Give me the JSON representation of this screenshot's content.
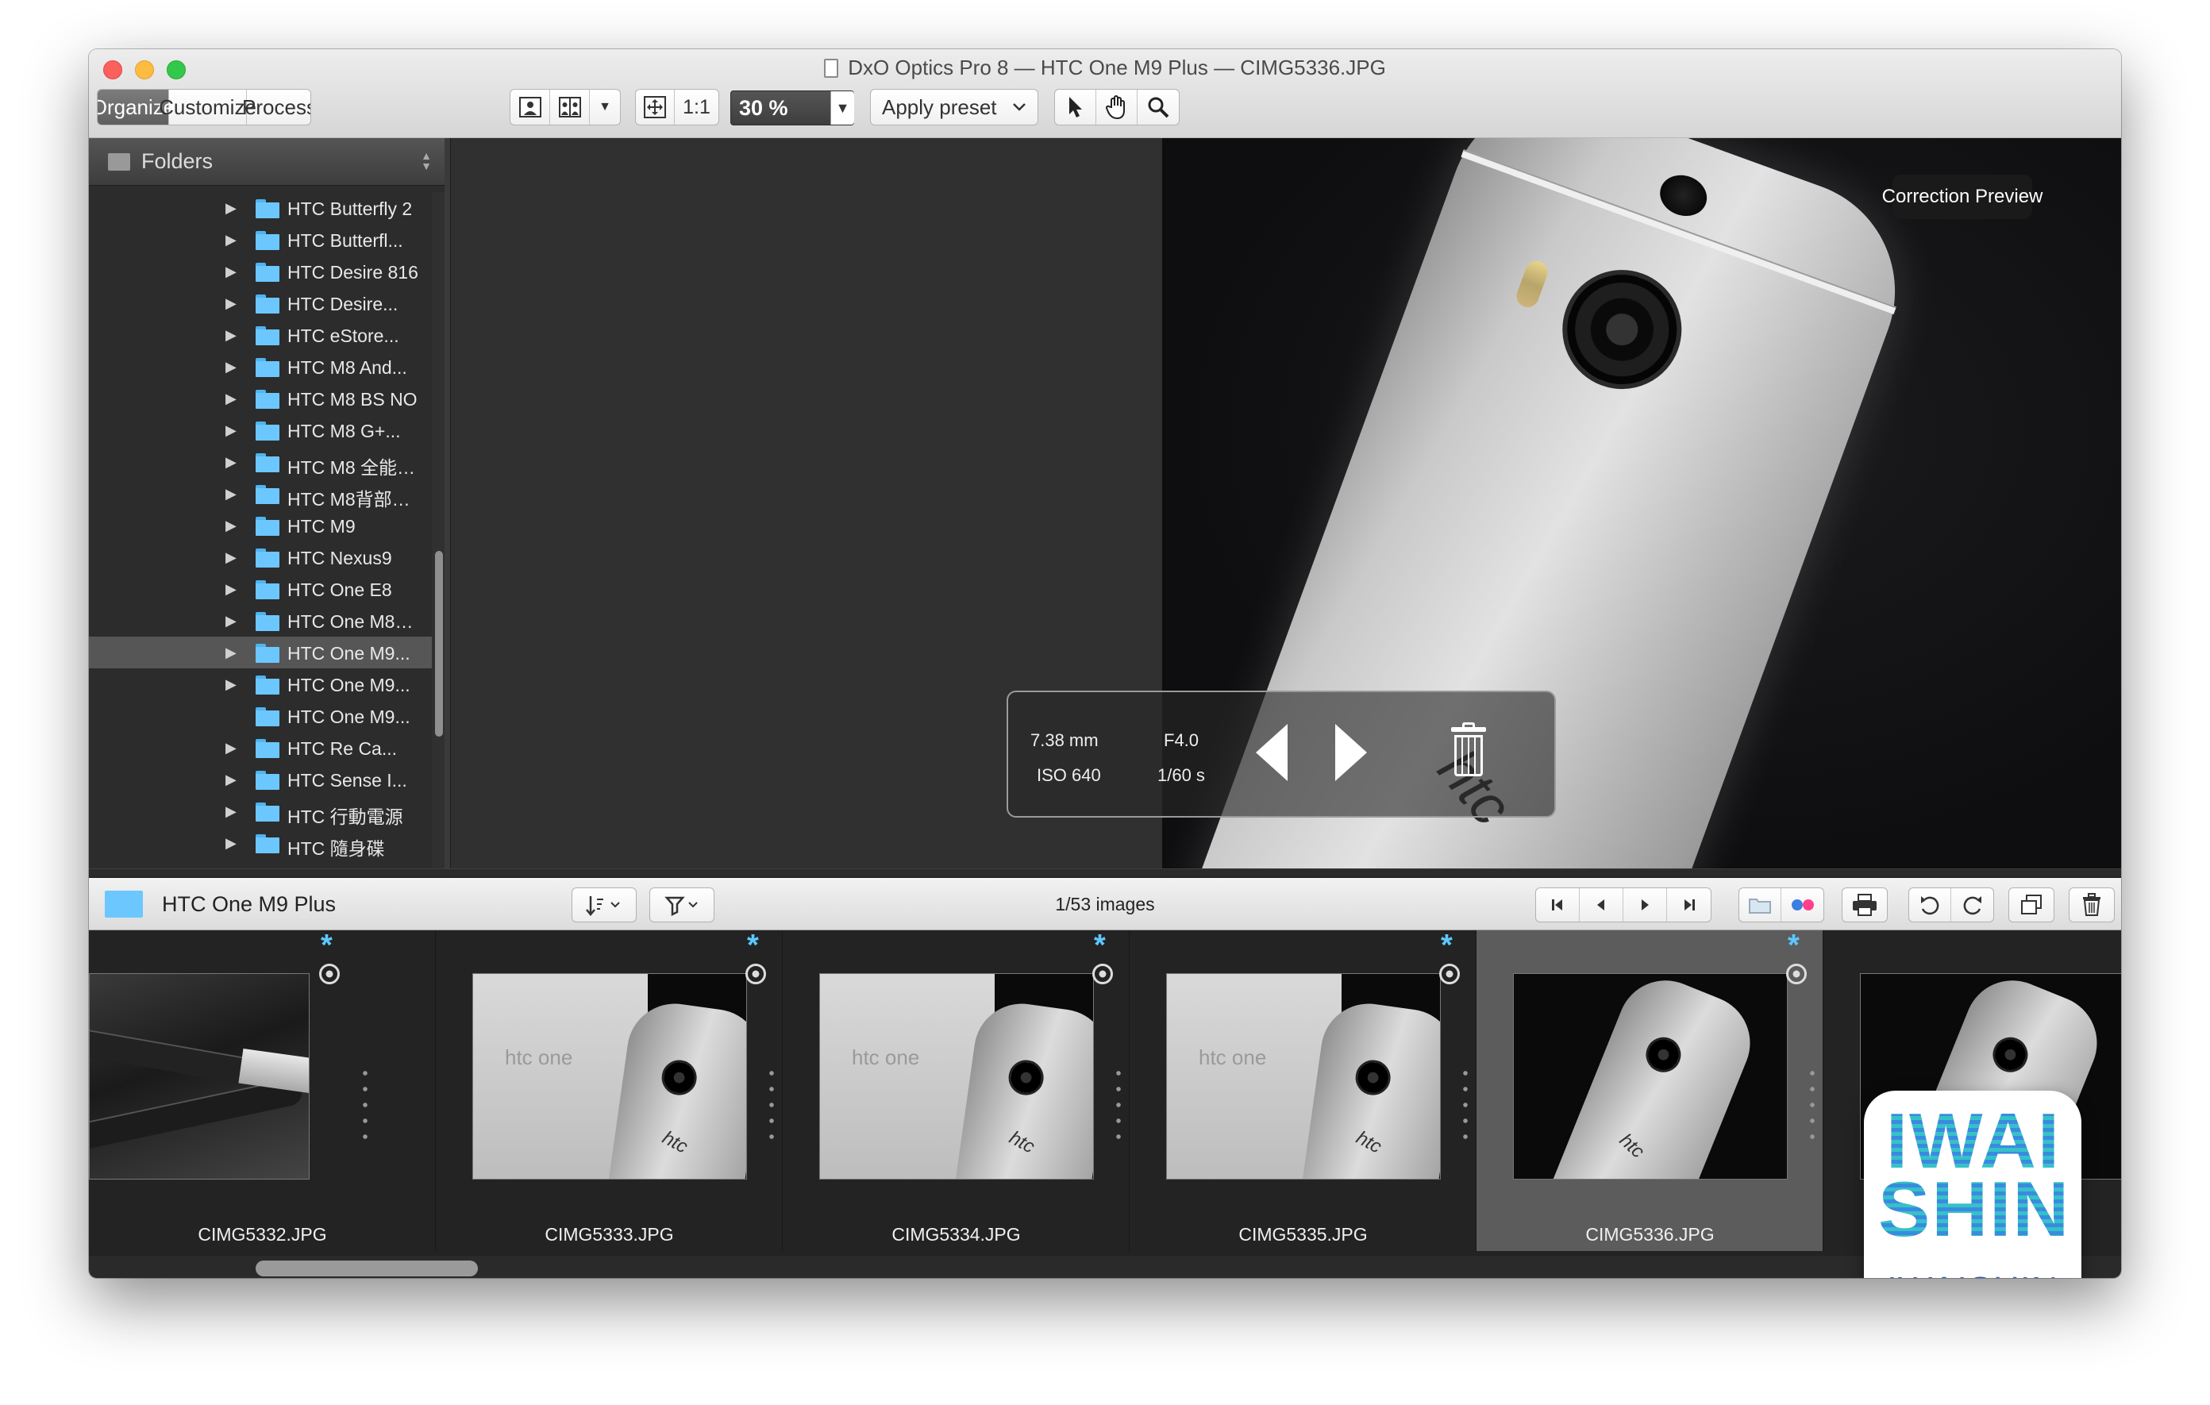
{
  "window": {
    "title": "DxO Optics Pro 8 — HTC One M9 Plus — CIMG5336.JPG"
  },
  "toolbar": {
    "tabs": [
      "Organize",
      "Customize",
      "Process"
    ],
    "active_tab": "Organize",
    "one_to_one": "1:1",
    "zoom": "30 %",
    "apply_preset": "Apply preset",
    "icons": [
      "single-view-icon",
      "compare-view-icon",
      "fit-screen-icon",
      "pointer-icon",
      "hand-icon",
      "magnifier-icon"
    ]
  },
  "sidebar": {
    "header": "Folders",
    "folders": [
      {
        "label": "HTC Butterfly 2",
        "expandable": true
      },
      {
        "label": "HTC Butterfl...",
        "expandable": true
      },
      {
        "label": "HTC Desire 816",
        "expandable": true
      },
      {
        "label": "HTC Desire...",
        "expandable": true
      },
      {
        "label": "HTC eStore...",
        "expandable": true
      },
      {
        "label": "HTC M8 And...",
        "expandable": true
      },
      {
        "label": "HTC M8 BS NO",
        "expandable": true
      },
      {
        "label": "HTC M8 G+...",
        "expandable": true
      },
      {
        "label": "HTC M8 全能…",
        "expandable": true
      },
      {
        "label": "HTC M8背部…",
        "expandable": true
      },
      {
        "label": "HTC M9",
        "expandable": true
      },
      {
        "label": "HTC Nexus9",
        "expandable": true
      },
      {
        "label": "HTC One E8",
        "expandable": true
      },
      {
        "label": "HTC One M8…",
        "expandable": true
      },
      {
        "label": "HTC One M9...",
        "expandable": true,
        "selected": true
      },
      {
        "label": "HTC One M9...",
        "expandable": true
      },
      {
        "label": "HTC One M9...",
        "expandable": false
      },
      {
        "label": "HTC Re Ca...",
        "expandable": true
      },
      {
        "label": "HTC Sense I...",
        "expandable": true
      },
      {
        "label": "HTC 行動電源",
        "expandable": true
      },
      {
        "label": "HTC 隨身碟",
        "expandable": true
      }
    ]
  },
  "viewer": {
    "correction_preview": "Correction Preview",
    "photo_logo": "htc",
    "overlay": {
      "focal_length": "7.38 mm",
      "aperture": "F4.0",
      "iso": "ISO 640",
      "shutter": "1/60 s"
    }
  },
  "filmstrip_toolbar": {
    "folder_name": "HTC One M9 Plus",
    "count": "1/53 images"
  },
  "filmstrip": {
    "thumbs": [
      {
        "filename": "CIMG5332.JPG",
        "selected": false,
        "scene": "cable"
      },
      {
        "filename": "CIMG5333.JPG",
        "selected": false,
        "scene": "box"
      },
      {
        "filename": "CIMG5334.JPG",
        "selected": false,
        "scene": "box"
      },
      {
        "filename": "CIMG5335.JPG",
        "selected": false,
        "scene": "box"
      },
      {
        "filename": "CIMG5336.JPG",
        "selected": true,
        "scene": "phone"
      },
      {
        "filename": "",
        "selected": false,
        "scene": "phone"
      }
    ],
    "box_brand": "htc one"
  },
  "watermark": {
    "big": "IWAI\nSHIN",
    "small": "IWAISHIN"
  },
  "colors": {
    "folder_blue": "#6cc7ff",
    "star_blue": "#5ec8ff",
    "active_tab": "#6d6d6d"
  }
}
